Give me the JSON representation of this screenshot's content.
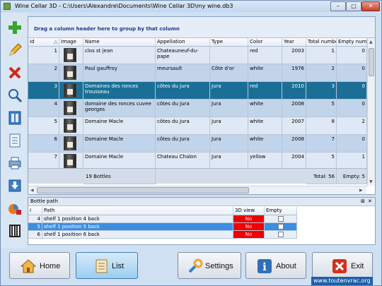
{
  "window": {
    "title": "Wine Cellar 3D - C:\\Users\\Alexandre\\Documents\\Wine Cellar 3D\\my wine.db3",
    "min_label": "–",
    "max_label": "□",
    "close_label": "✕"
  },
  "toolbar": {
    "icons": [
      "add-icon",
      "edit-pencil-icon",
      "delete-icon",
      "search-icon",
      "cellar-icon",
      "document-icon",
      "print-icon",
      "import-icon",
      "chart-icon",
      "barcode-icon"
    ]
  },
  "grid": {
    "group_hint": "Drag a column header here to group by that column",
    "columns": [
      "Id",
      "Image",
      "Name",
      "Appellation",
      "Type",
      "Color",
      "Year",
      "Total numbe",
      "Empty numb"
    ],
    "rows": [
      {
        "id": "1",
        "name": "clos st jean",
        "appellation": "Chateauneuf-du-pape",
        "type": "",
        "color": "red",
        "year": "2003",
        "total": "1",
        "empty": "0"
      },
      {
        "id": "2",
        "name": "Paul gauffroy",
        "appellation": "meursault",
        "type": "Côte d'or",
        "color": "white",
        "year": "1976",
        "total": "2",
        "empty": "0"
      },
      {
        "id": "3",
        "name": "Domaines des ronces trousseau",
        "appellation": "côtes du Jura",
        "type": "Jura",
        "color": "red",
        "year": "2010",
        "total": "3",
        "empty": "0"
      },
      {
        "id": "4",
        "name": "domaine des ronces cuvee georges",
        "appellation": "côtes du Jura",
        "type": "Jura",
        "color": "white",
        "year": "2008",
        "total": "5",
        "empty": "0"
      },
      {
        "id": "5",
        "name": "Domaine Macle",
        "appellation": "côtes du Jura",
        "type": "Jura",
        "color": "white",
        "year": "2007",
        "total": "8",
        "empty": "2"
      },
      {
        "id": "6",
        "name": "Domaine Macle",
        "appellation": "côtes du Jura",
        "type": "Jura",
        "color": "white",
        "year": "2008",
        "total": "7",
        "empty": "0"
      },
      {
        "id": "7",
        "name": "Domaine Macle",
        "appellation": "Chateau Chalon",
        "type": "Jura",
        "color": "yellow",
        "year": "2004",
        "total": "5",
        "empty": "1"
      }
    ],
    "footer": {
      "bottles": "19 Bottles",
      "total": "Total: 56",
      "empty": "Empty: 5"
    }
  },
  "bottle_path": {
    "title": "Bottle path",
    "columns": [
      "I",
      "Path",
      "3D view",
      "Empty"
    ],
    "rows": [
      {
        "i": "4",
        "path": "shelf 1 position 4 back",
        "view": "No"
      },
      {
        "i": "5",
        "path": "shelf 1 position 5 back",
        "view": "No"
      },
      {
        "i": "6",
        "path": "shelf 1 position 6 back",
        "view": "No"
      }
    ]
  },
  "buttons": {
    "home": "Home",
    "list": "List",
    "settings": "Settings",
    "about": "About",
    "exit": "Exit"
  },
  "watermark": "www.toutenvrac.org"
}
